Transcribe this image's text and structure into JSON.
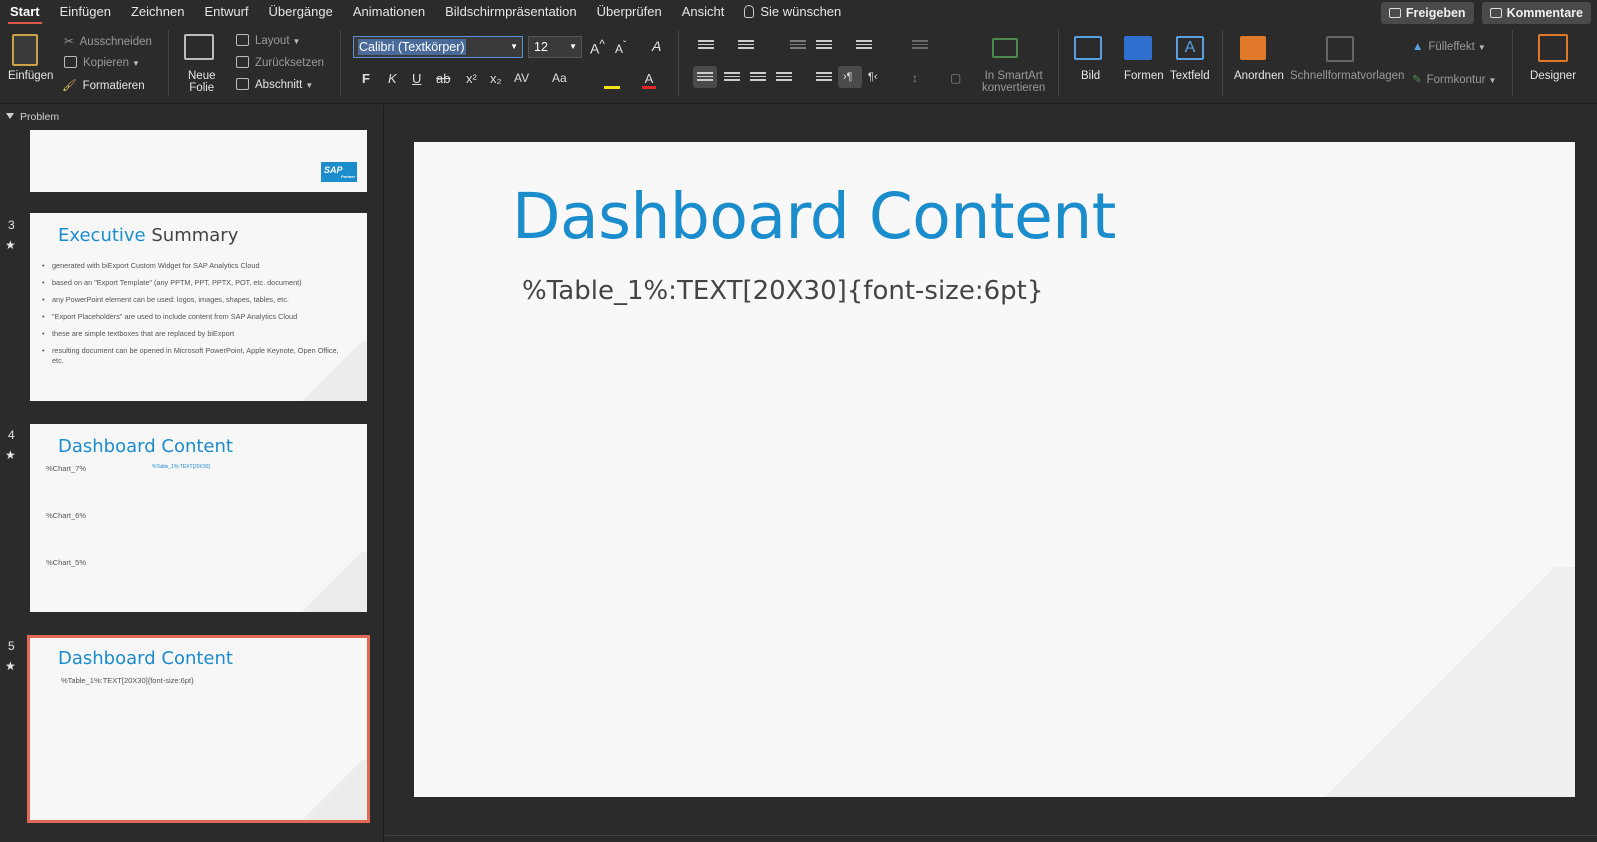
{
  "menu": {
    "tabs": [
      "Start",
      "Einfügen",
      "Zeichnen",
      "Entwurf",
      "Übergänge",
      "Animationen",
      "Bildschirmpräsentation",
      "Überprüfen",
      "Ansicht"
    ],
    "tell_me": "Sie wünschen",
    "share": "Freigeben",
    "comments": "Kommentare"
  },
  "ribbon": {
    "paste": "Einfügen",
    "cut": "Ausschneiden",
    "copy": "Kopieren",
    "format_painter": "Formatieren",
    "new_slide_1": "Neue",
    "new_slide_2": "Folie",
    "layout": "Layout",
    "reset": "Zurücksetzen",
    "section": "Abschnitt",
    "font_name": "Calibri (Textkörper)",
    "font_size": "12",
    "bold": "F",
    "italic": "K",
    "underline": "U",
    "strike": "ab",
    "smartart_1": "In SmartArt",
    "smartart_2": "konvertieren",
    "picture": "Bild",
    "shapes": "Formen",
    "textbox": "Textfeld",
    "arrange": "Anordnen",
    "quick_styles": "Schnellformatvorlagen",
    "fill": "Fülleffekt",
    "outline": "Formkontur",
    "designer": "Designer"
  },
  "panel": {
    "section": "Problem",
    "slides": [
      {
        "num": "3",
        "title_blue": "Executive",
        "title_gray": "Summary",
        "bullets": [
          "generated with biExport Custom Widget for SAP Analytics Cloud",
          "based on an \"Export Template\" (any PPTM, PPT, PPTX, POT, etc. document)",
          "any PowerPoint element can be used: logos, images, shapes, tables, etc.",
          "\"Export Placeholders\" are used to include content from SAP Analytics Cloud",
          "these are simple textboxes that are replaced by biExport",
          "resulting document can be opened in Microsoft PowerPoint, Apple Keynote, Open Office, etc."
        ]
      },
      {
        "num": "4",
        "title": "Dashboard Content",
        "ph1": "%Chart_7%",
        "ph2": "%Chart_6%",
        "ph3": "%Chart_5%",
        "ph_small": "%Table_1%:TEXT[20X30]"
      },
      {
        "num": "5",
        "title": "Dashboard Content",
        "body": "%Table_1%:TEXT[20X30]{font-size:6pt}"
      }
    ],
    "logo_text": "SAP",
    "logo_sub": "Partner"
  },
  "slide": {
    "title": "Dashboard Content",
    "body": "%Table_1%:TEXT[20X30]{font-size:6pt}"
  }
}
